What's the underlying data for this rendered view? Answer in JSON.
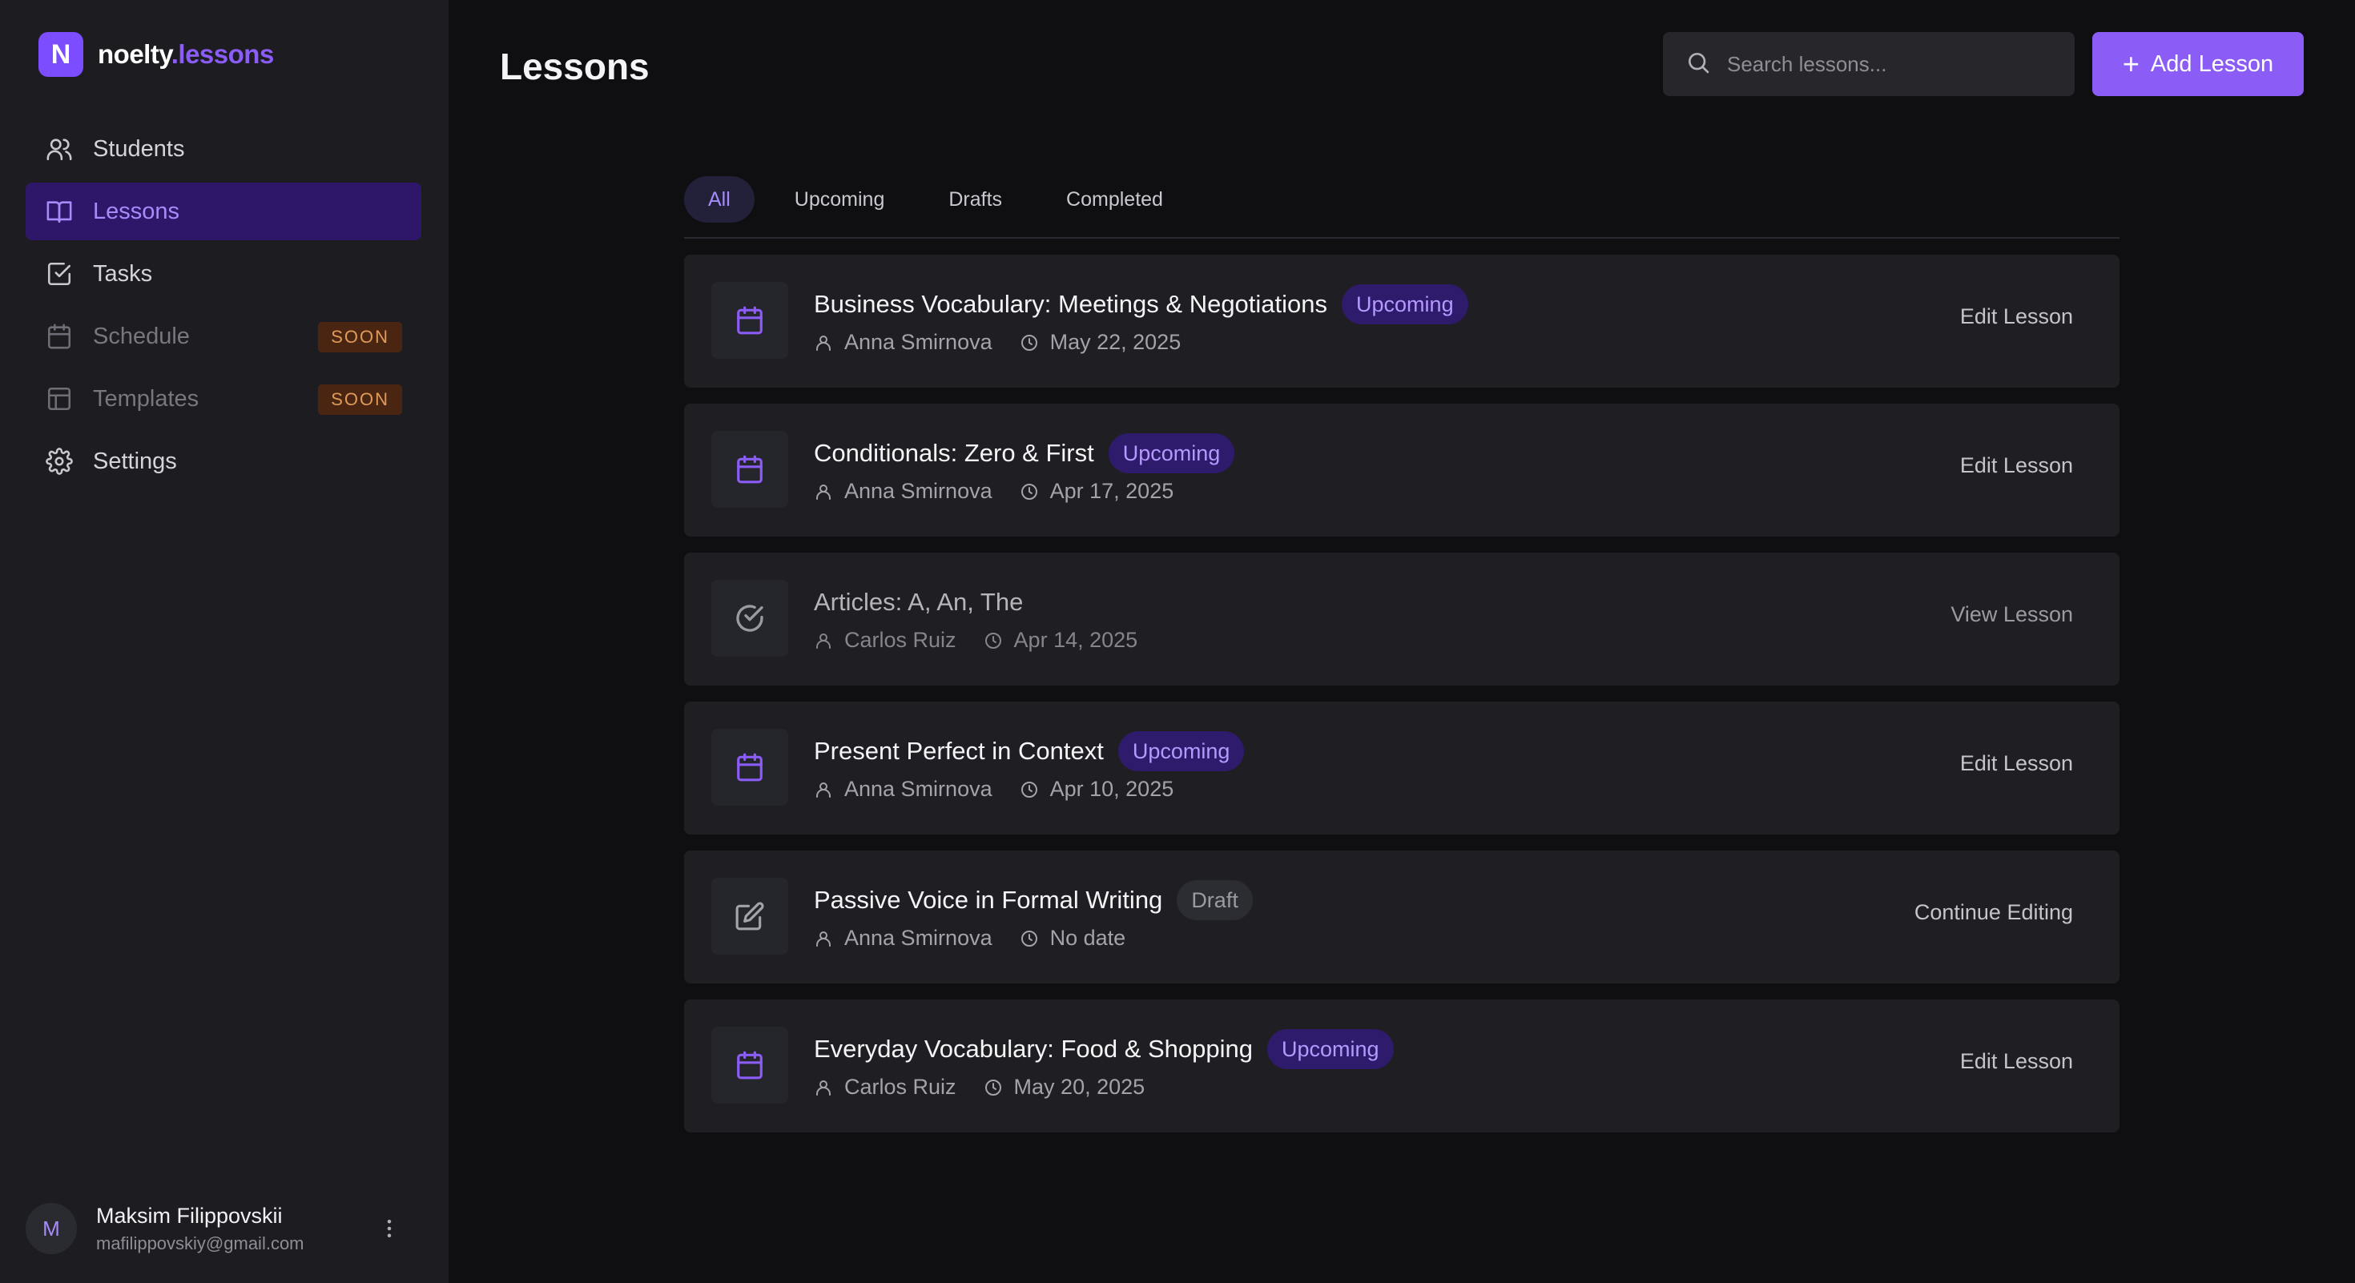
{
  "brand": {
    "name_part1": "noelty",
    "name_part2": ".lessons",
    "logo_letter": "N"
  },
  "sidebar": {
    "items": [
      {
        "label": "Students",
        "icon": "users-icon"
      },
      {
        "label": "Lessons",
        "icon": "book-icon",
        "active": true
      },
      {
        "label": "Tasks",
        "icon": "check-square-icon"
      },
      {
        "label": "Schedule",
        "icon": "calendar-icon",
        "badge": "SOON"
      },
      {
        "label": "Templates",
        "icon": "layout-icon",
        "badge": "SOON"
      },
      {
        "label": "Settings",
        "icon": "gear-icon"
      }
    ]
  },
  "user": {
    "initial": "M",
    "name": "Maksim Filippovskii",
    "email": "mafilippovskiy@gmail.com"
  },
  "header": {
    "title": "Lessons",
    "search_placeholder": "Search lessons...",
    "add_label": "Add Lesson"
  },
  "tabs": [
    {
      "label": "All",
      "active": true
    },
    {
      "label": "Upcoming"
    },
    {
      "label": "Drafts"
    },
    {
      "label": "Completed"
    }
  ],
  "lessons": [
    {
      "title": "Business Vocabulary: Meetings & Negotiations",
      "status": "Upcoming",
      "student": "Anna Smirnova",
      "date": "May 22, 2025",
      "action": "Edit Lesson",
      "icon": "calendar-icon"
    },
    {
      "title": "Conditionals: Zero & First",
      "status": "Upcoming",
      "student": "Anna Smirnova",
      "date": "Apr 17, 2025",
      "action": "Edit Lesson",
      "icon": "calendar-icon"
    },
    {
      "title": "Articles: A, An, The",
      "status": "",
      "student": "Carlos Ruiz",
      "date": "Apr 14, 2025",
      "action": "View Lesson",
      "icon": "check-circle-icon"
    },
    {
      "title": "Present Perfect in Context",
      "status": "Upcoming",
      "student": "Anna Smirnova",
      "date": "Apr 10, 2025",
      "action": "Edit Lesson",
      "icon": "calendar-icon"
    },
    {
      "title": "Passive Voice in Formal Writing",
      "status": "Draft",
      "student": "Anna Smirnova",
      "date": "No date",
      "action": "Continue Editing",
      "icon": "edit-icon"
    },
    {
      "title": "Everyday Vocabulary: Food & Shopping",
      "status": "Upcoming",
      "student": "Carlos Ruiz",
      "date": "May 20, 2025",
      "action": "Edit Lesson",
      "icon": "calendar-icon"
    }
  ],
  "colors": {
    "accent": "#8b5cf6",
    "badge_upcoming_bg": "#2f1b6b",
    "soon_bg": "#4a2612",
    "soon_fg": "#e09a5a"
  }
}
